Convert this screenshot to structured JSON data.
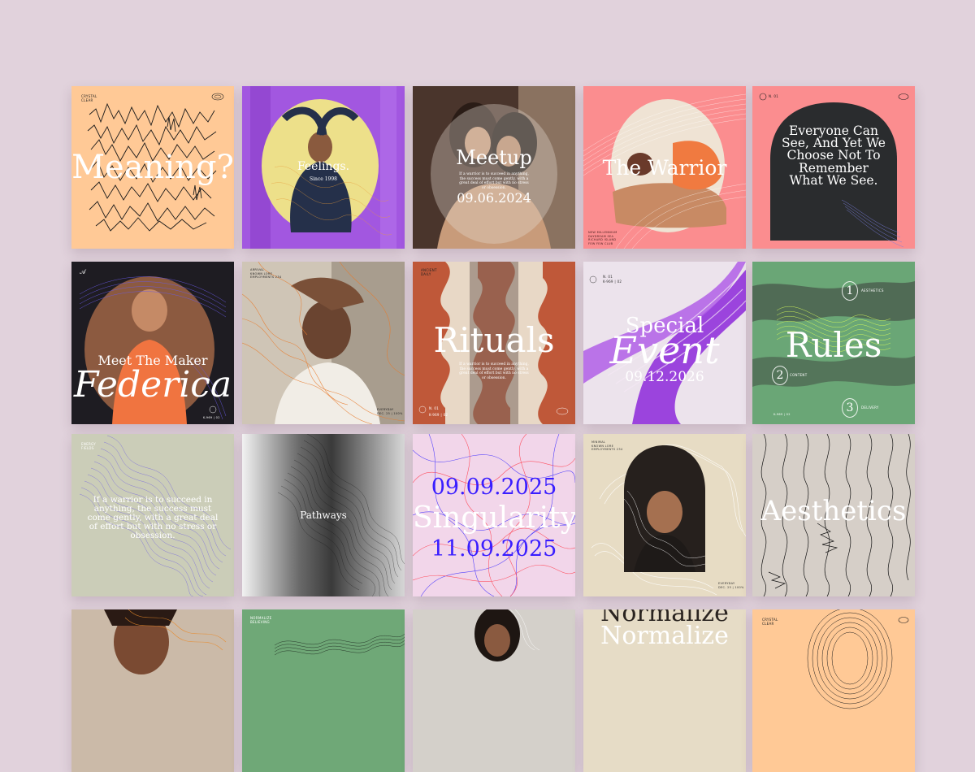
{
  "colors": {
    "page_bg": "#e1d2dc",
    "peach": "#ffc996",
    "purple": "#9b4fd8",
    "pink": "#fb8d8f",
    "rust": "#c05a3a",
    "green": "#6ea877",
    "sage": "#c9ccb6",
    "cream": "#e6dcc6"
  },
  "r1": {
    "t1": {
      "brand": "CRYSTAL CLEAR",
      "title": "Meaning?"
    },
    "t2": {
      "title": "Feelings.",
      "sub": "Since 1998"
    },
    "t3": {
      "title": "Meetup",
      "body": "If a warrior is to succeed in anything, the success must come gently, with a great deal of effort but with no stress or obsession.",
      "date": "09.06.2024"
    },
    "t4": {
      "title": "The Warrior",
      "footer": "NEW MILLENNIUM\nDAYDREAM SEA\nRICHARD ISLAND\nFEW FEW CLUB"
    },
    "t5": {
      "label": "N. 01",
      "title": "Everyone Can See, And Yet We Choose Not To Remember What We See."
    }
  },
  "r2": {
    "t1": {
      "small": "Meet The Maker",
      "title": "Federica",
      "code": "K-969 | 02"
    },
    "t2": {
      "top": "ARRIVAL\nKNOWN LORE\nEMPLOYMENTS 234",
      "bottom": "EVERYDAY\nDEC. 25 | 100%"
    },
    "t3": {
      "brand": "ANCIENT DAILY",
      "title": "Rituals",
      "body": "If a warrior is to succeed in anything, the success must come gently, with a great deal of effort but with no stress or obsession.",
      "label": "N. 01",
      "code": "K-969 | 02"
    },
    "t4": {
      "label": "N. 01",
      "code": "K-969 | 02",
      "line1": "Special",
      "line2": "Event",
      "date": "09.12.2026"
    },
    "t5": {
      "title": "Rules",
      "items": [
        {
          "num": "1",
          "label": "AESTHETICS"
        },
        {
          "num": "2",
          "label": "CONTENT"
        },
        {
          "num": "3",
          "label": "DELIVERY"
        }
      ],
      "code": "K-969 | 02"
    }
  },
  "r3": {
    "t1": {
      "brand": "ENERGY FIELDS",
      "body": "If a warrior is to succeed in anything, the success must come gently, with a great deal of effort but with no stress or obsession."
    },
    "t2": {
      "title": "Pathways"
    },
    "t3": {
      "date1": "09.09.2025",
      "title": "Singularity",
      "date2": "11.09.2025"
    },
    "t4": {
      "top": "MINIMAL\nKNOWN LORE\nEMPLOYMENTS 234",
      "bottom": "EVERYDAY\nDEC. 25 | 100%"
    },
    "t5": {
      "title": "Aesthetics"
    }
  },
  "r4": {
    "t2": {
      "brand": "NORMALIZE BELIEVING"
    },
    "t4": {
      "line1": "Normalize",
      "line2": "Normalize"
    },
    "t5": {
      "brand": "CRYSTAL CLEAR"
    }
  }
}
